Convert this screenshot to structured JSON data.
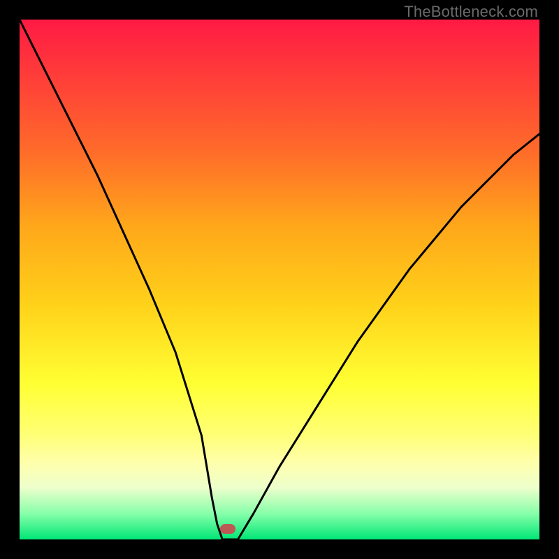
{
  "watermark": "TheBottleneck.com",
  "chart_data": {
    "type": "line",
    "title": "",
    "xlabel": "",
    "ylabel": "",
    "xlim": [
      0,
      100
    ],
    "ylim": [
      0,
      100
    ],
    "series": [
      {
        "name": "bottleneck-curve",
        "x": [
          0,
          5,
          10,
          15,
          20,
          25,
          30,
          35,
          37,
          38,
          39,
          40,
          41,
          42,
          45,
          50,
          55,
          60,
          65,
          70,
          75,
          80,
          85,
          90,
          95,
          100
        ],
        "values": [
          100,
          90,
          80,
          70,
          59,
          48,
          36,
          20,
          8,
          3,
          0,
          0,
          0,
          0,
          5,
          14,
          22,
          30,
          38,
          45,
          52,
          58,
          64,
          69,
          74,
          78
        ]
      }
    ],
    "annotations": [
      {
        "name": "minimum-marker",
        "x": 40,
        "y": 2
      }
    ],
    "grid": false,
    "legend": false
  }
}
